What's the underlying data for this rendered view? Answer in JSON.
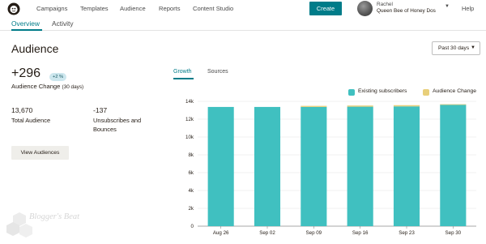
{
  "nav": {
    "items": [
      "Campaigns",
      "Templates",
      "Audience",
      "Reports",
      "Content Studio"
    ],
    "create_label": "Create",
    "account_name": "Rachel",
    "account_org": "Queen Bee of Honey Dos",
    "help_label": "Help"
  },
  "subtabs": [
    "Overview",
    "Activity"
  ],
  "page": {
    "title": "Audience",
    "date_range": "Past 30 days"
  },
  "summary": {
    "change_value": "+296",
    "change_badge": "+2 %",
    "change_label": "Audience Change",
    "change_period": "(30 days)",
    "total_value": "13,670",
    "total_label": "Total Audience",
    "unsub_value": "-137",
    "unsub_label_1": "Unsubscribes and",
    "unsub_label_2": "Bounces",
    "view_button": "View Audiences"
  },
  "chart_tabs": [
    "Growth",
    "Sources"
  ],
  "watermark": "Blogger's Beat",
  "chart_data": {
    "type": "bar",
    "stacked": true,
    "categories": [
      "Aug 26",
      "Sep 02",
      "Sep 09",
      "Sep 16",
      "Sep 23",
      "Sep 30"
    ],
    "series": [
      {
        "name": "Existing subscribers",
        "color": "#40c0c0",
        "values": [
          13370,
          13370,
          13370,
          13400,
          13430,
          13650
        ]
      },
      {
        "name": "Audience Change",
        "color": "#e8cf7a",
        "values": [
          0,
          0,
          120,
          130,
          140,
          20
        ]
      }
    ],
    "y_ticks": [
      "0",
      "2k",
      "4k",
      "6k",
      "8k",
      "10k",
      "12k",
      "14k"
    ],
    "ylim": [
      0,
      14000
    ],
    "legend_position": "top-right",
    "grid": true
  }
}
